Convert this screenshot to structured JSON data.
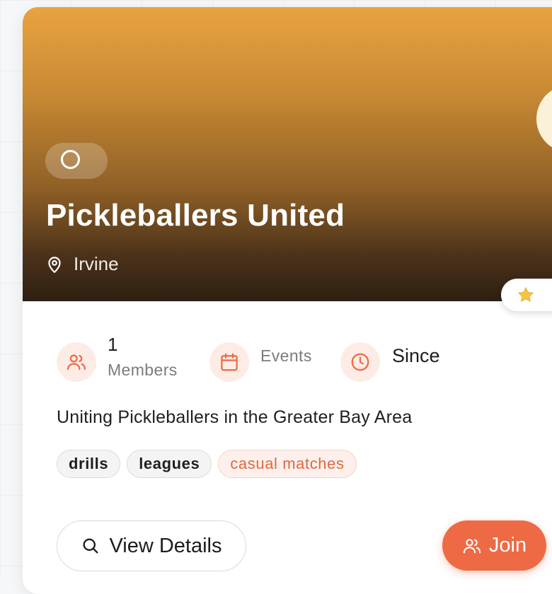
{
  "club": {
    "name": "Pickleballers United",
    "location": "Irvine",
    "description": "Uniting Pickleballers in the Greater Bay Area"
  },
  "stats": {
    "members_count": "1",
    "members_label": "Members",
    "events_label": "Events",
    "since_label": "Since"
  },
  "tags": [
    "drills",
    "leagues",
    "casual matches"
  ],
  "actions": {
    "view_details": "View Details",
    "join": "Join"
  },
  "icons": {
    "badge": "circle-outline-icon",
    "location": "map-pin-icon",
    "favorite": "star-icon",
    "members": "users-icon",
    "events": "calendar-icon",
    "since": "clock-icon",
    "view": "search-icon",
    "join": "users-icon"
  },
  "colors": {
    "accent": "#ee6a44",
    "accent_tint": "#fdece6",
    "star": "#f4c542",
    "hero_top": "#e9a340",
    "hero_bottom": "#2e1f12"
  }
}
